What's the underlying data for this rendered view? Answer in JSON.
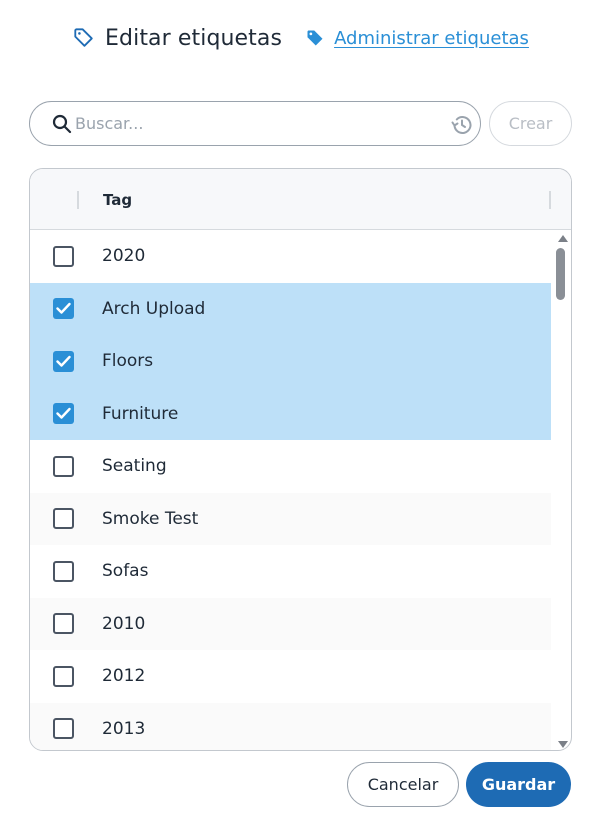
{
  "header": {
    "title": "Editar etiquetas",
    "title_icon": "tag-outline-icon",
    "manage_link": "Administrar etiquetas",
    "manage_icon": "tag-filled-icon"
  },
  "search": {
    "placeholder": "Buscar...",
    "value": "",
    "create_label": "Crear"
  },
  "table": {
    "column_header": "Tag",
    "rows": [
      {
        "label": "2020",
        "checked": false
      },
      {
        "label": "Arch Upload",
        "checked": true
      },
      {
        "label": "Floors",
        "checked": true
      },
      {
        "label": "Furniture",
        "checked": true
      },
      {
        "label": "Seating",
        "checked": false
      },
      {
        "label": "Smoke Test",
        "checked": false
      },
      {
        "label": "Sofas",
        "checked": false
      },
      {
        "label": "2010",
        "checked": false
      },
      {
        "label": "2012",
        "checked": false
      },
      {
        "label": "2013",
        "checked": false
      }
    ]
  },
  "footer": {
    "cancel_label": "Cancelar",
    "save_label": "Guardar"
  },
  "colors": {
    "accent": "#2a8fd6",
    "primary_button": "#1e6bb4",
    "selected_row": "#bde0f8"
  }
}
